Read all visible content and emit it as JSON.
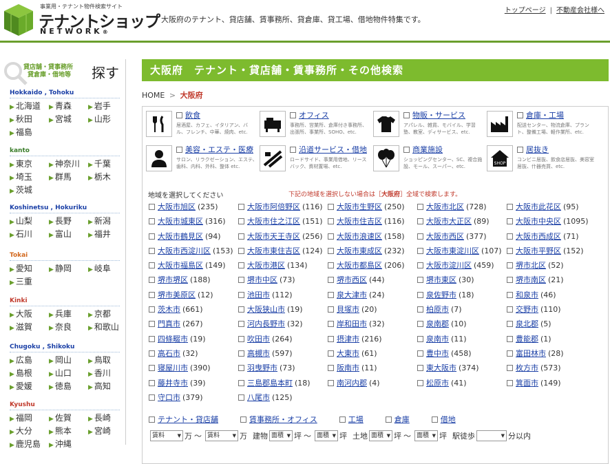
{
  "header": {
    "logo_sub": "事業用・テナント物件検索サイト",
    "logo_main": "テナントショップ",
    "logo_net": "NETWORK",
    "logo_reg": "®",
    "tagline": "大阪府のテナント、貸店舗、賃事務所、貸倉庫、貸工場、借地物件特集です。",
    "links": [
      "トップページ",
      "不動産会社様へ"
    ]
  },
  "sidebar": {
    "subtitle_line1": "貸店舗・貸事務所",
    "subtitle_line2": "貸倉庫・借地等",
    "sagasu": "探す",
    "regions": [
      {
        "title": "Hokkaido , Tohoku",
        "color": "blue",
        "prefs": [
          "北海道",
          "青森",
          "岩手",
          "秋田",
          "宮城",
          "山形",
          "福島"
        ]
      },
      {
        "title": "kanto",
        "color": "green",
        "prefs": [
          "東京",
          "神奈川",
          "千葉",
          "埼玉",
          "群馬",
          "栃木",
          "茨城"
        ]
      },
      {
        "title": "Koshinetsu , Hokuriku",
        "color": "blue",
        "prefs": [
          "山梨",
          "長野",
          "新潟",
          "石川",
          "富山",
          "福井"
        ]
      },
      {
        "title": "Tokai",
        "color": "orange",
        "prefs": [
          "愛知",
          "静岡",
          "岐阜",
          "三重"
        ]
      },
      {
        "title": "Kinki",
        "color": "red",
        "prefs": [
          "大阪",
          "兵庫",
          "京都",
          "滋賀",
          "奈良",
          "和歌山"
        ]
      },
      {
        "title": "Chugoku , Shikoku",
        "color": "blue",
        "prefs": [
          "広島",
          "岡山",
          "鳥取",
          "島根",
          "山口",
          "香川",
          "愛媛",
          "徳島",
          "高知"
        ]
      },
      {
        "title": "Kyushu",
        "color": "red",
        "prefs": [
          "福岡",
          "佐賀",
          "長崎",
          "大分",
          "熊本",
          "宮崎",
          "鹿児島",
          "沖縄"
        ]
      }
    ]
  },
  "main": {
    "title": "大阪府　テナント・貸店舗・賃事務所・その他検索",
    "breadcrumb_home": "HOME",
    "breadcrumb_sep": ">",
    "breadcrumb_current": "大阪府",
    "categories": [
      {
        "icon": "restaurant-icon",
        "label": "飲食",
        "desc": "居酒屋、カフェ、イタリアン、バル、フレンチ、中華、焼肉、etc."
      },
      {
        "icon": "office-icon",
        "label": "オフィス",
        "desc": "事務所、営業所、倉庫付き事務所、出張所、事業所、SOHO、etc."
      },
      {
        "icon": "shirt-icon",
        "label": "物販・サービス",
        "desc": "アパレル、雑貨、モバイル、学習塾、教室、ディサービス、etc."
      },
      {
        "icon": "factory-icon",
        "label": "倉庫・工場",
        "desc": "配送センター、物流倉庫、プラント、整備工場、軽作業所、etc."
      },
      {
        "icon": "person-icon",
        "label": "美容・エステ・医療",
        "desc": "サロン、リラクゼーション、エステ、歯科、内科、外科、整体 etc."
      },
      {
        "icon": "road-icon",
        "label": "沿道サービス・借地",
        "desc": "ロードサイド、事業用借地、リースバック、資材置場、etc."
      },
      {
        "icon": "balloon-icon",
        "label": "商業施設",
        "desc": "ショッピングセンター、SC、複合施設、モール、スーパー、etc."
      },
      {
        "icon": "shop-icon",
        "label": "居抜き",
        "desc": "コンビニ居抜、飲食店居抜、美容室居抜、什器売買、etc."
      }
    ],
    "area_hint_left": "地域を選択してください",
    "area_hint_right_pre": "下記の地域を選択しない場合は［",
    "area_hint_right_bold": "大阪府",
    "area_hint_right_post": "］全域で検索します。",
    "cities": [
      {
        "name": "大阪市旭区",
        "count": "(235)"
      },
      {
        "name": "大阪市阿倍野区",
        "count": "(116)"
      },
      {
        "name": "大阪市生野区",
        "count": "(250)"
      },
      {
        "name": "大阪市北区",
        "count": "(728)"
      },
      {
        "name": "大阪市此花区",
        "count": "(95)"
      },
      {
        "name": "大阪市城東区",
        "count": "(316)"
      },
      {
        "name": "大阪市住之江区",
        "count": "(151)"
      },
      {
        "name": "大阪市住吉区",
        "count": "(116)"
      },
      {
        "name": "大阪市大正区",
        "count": "(89)"
      },
      {
        "name": "大阪市中央区",
        "count": "(1095)"
      },
      {
        "name": "大阪市鶴見区",
        "count": "(94)"
      },
      {
        "name": "大阪市天王寺区",
        "count": "(256)"
      },
      {
        "name": "大阪市浪速区",
        "count": "(158)"
      },
      {
        "name": "大阪市西区",
        "count": "(377)"
      },
      {
        "name": "大阪市西成区",
        "count": "(71)"
      },
      {
        "name": "大阪市西淀川区",
        "count": "(153)"
      },
      {
        "name": "大阪市東住吉区",
        "count": "(124)"
      },
      {
        "name": "大阪市東成区",
        "count": "(232)"
      },
      {
        "name": "大阪市東淀川区",
        "count": "(107)"
      },
      {
        "name": "大阪市平野区",
        "count": "(152)"
      },
      {
        "name": "大阪市福島区",
        "count": "(149)"
      },
      {
        "name": "大阪市港区",
        "count": "(134)"
      },
      {
        "name": "大阪市都島区",
        "count": "(206)"
      },
      {
        "name": "大阪市淀川区",
        "count": "(459)"
      },
      {
        "name": "堺市北区",
        "count": "(52)"
      },
      {
        "name": "堺市堺区",
        "count": "(188)"
      },
      {
        "name": "堺市中区",
        "count": "(73)"
      },
      {
        "name": "堺市西区",
        "count": "(44)"
      },
      {
        "name": "堺市東区",
        "count": "(30)"
      },
      {
        "name": "堺市南区",
        "count": "(21)"
      },
      {
        "name": "堺市美原区",
        "count": "(12)"
      },
      {
        "name": "池田市",
        "count": "(112)"
      },
      {
        "name": "泉大津市",
        "count": "(24)"
      },
      {
        "name": "泉佐野市",
        "count": "(18)"
      },
      {
        "name": "和泉市",
        "count": "(46)"
      },
      {
        "name": "茨木市",
        "count": "(661)"
      },
      {
        "name": "大阪狭山市",
        "count": "(19)"
      },
      {
        "name": "貝塚市",
        "count": "(20)"
      },
      {
        "name": "柏原市",
        "count": "(7)"
      },
      {
        "name": "交野市",
        "count": "(110)"
      },
      {
        "name": "門真市",
        "count": "(267)"
      },
      {
        "name": "河内長野市",
        "count": "(32)"
      },
      {
        "name": "岸和田市",
        "count": "(32)"
      },
      {
        "name": "泉南郡",
        "count": "(10)"
      },
      {
        "name": "泉北郡",
        "count": "(5)"
      },
      {
        "name": "四條畷市",
        "count": "(19)"
      },
      {
        "name": "吹田市",
        "count": "(264)"
      },
      {
        "name": "摂津市",
        "count": "(216)"
      },
      {
        "name": "泉南市",
        "count": "(11)"
      },
      {
        "name": "豊能郡",
        "count": "(1)"
      },
      {
        "name": "高石市",
        "count": "(32)"
      },
      {
        "name": "高槻市",
        "count": "(597)"
      },
      {
        "name": "大東市",
        "count": "(61)"
      },
      {
        "name": "豊中市",
        "count": "(458)"
      },
      {
        "name": "富田林市",
        "count": "(28)"
      },
      {
        "name": "寝屋川市",
        "count": "(390)"
      },
      {
        "name": "羽曳野市",
        "count": "(73)"
      },
      {
        "name": "阪南市",
        "count": "(11)"
      },
      {
        "name": "東大阪市",
        "count": "(374)"
      },
      {
        "name": "枚方市",
        "count": "(573)"
      },
      {
        "name": "藤井寺市",
        "count": "(39)"
      },
      {
        "name": "三島郡島本町",
        "count": "(18)"
      },
      {
        "name": "南河内郡",
        "count": "(4)"
      },
      {
        "name": "松原市",
        "count": "(41)"
      },
      {
        "name": "箕面市",
        "count": "(149)"
      },
      {
        "name": "守口市",
        "count": "(379)"
      },
      {
        "name": "八尾市",
        "count": "(125)"
      }
    ],
    "types": [
      "テナント・貸店舗",
      "賃事務所・オフィス",
      "工場",
      "倉庫",
      "借地"
    ],
    "filters": {
      "rent_label_min": "賃料",
      "rent_unit1": "万",
      "tilde": "〜",
      "rent_label_max": "賃料",
      "rent_unit2": "万",
      "building_label": "建物",
      "area_sel1": "面積",
      "tsubo1": "坪",
      "area_sel2": "面積",
      "tsubo2": "坪",
      "land_label": "土地",
      "land_sel1": "面積",
      "tsubo3": "坪",
      "land_sel2": "面積",
      "tsubo4": "坪",
      "walk_label": "駅徒歩",
      "walk_sel": "",
      "walk_unit": "分以内"
    }
  }
}
